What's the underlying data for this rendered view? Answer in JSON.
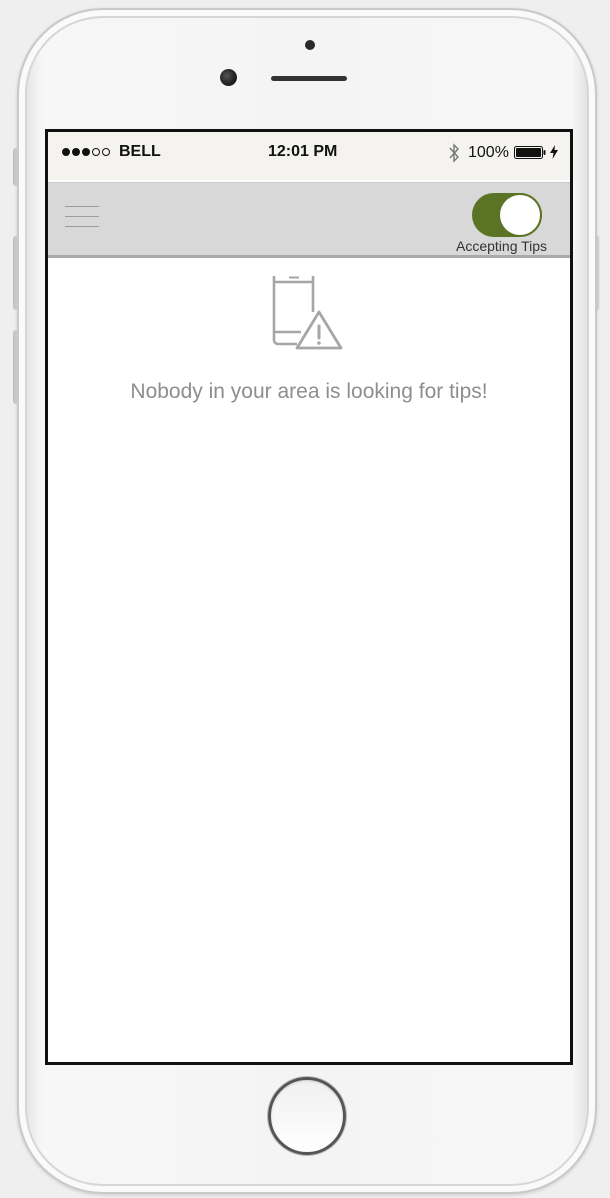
{
  "status_bar": {
    "signal_dots": [
      "filled",
      "filled",
      "filled",
      "empty",
      "empty"
    ],
    "carrier": "BELL",
    "time": "12:01 PM",
    "bluetooth_icon": "bluetooth-icon",
    "battery_percent": "100%",
    "battery_icon": "battery-full-icon",
    "charging_icon": "charging-bolt-icon"
  },
  "nav_bar": {
    "menu_icon": "hamburger-menu-icon",
    "toggle": {
      "label": "Accepting Tips",
      "on": true,
      "on_color": "#5b7325"
    }
  },
  "content": {
    "empty_state_icon": "phone-warning-icon",
    "message": "Nobody in your area is looking for tips!"
  }
}
